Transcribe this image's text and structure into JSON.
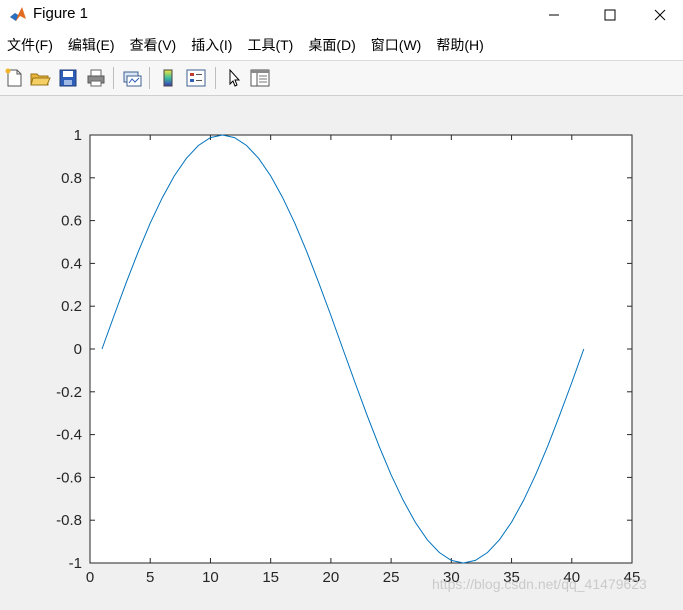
{
  "window": {
    "title": "Figure 1"
  },
  "menu": {
    "items": [
      "文件(F)",
      "编辑(E)",
      "查看(V)",
      "插入(I)",
      "工具(T)",
      "桌面(D)",
      "窗口(W)",
      "帮助(H)"
    ]
  },
  "toolbar": {
    "icons": [
      "new-figure-icon",
      "open-file-icon",
      "save-icon",
      "print-icon",
      "link-plot-icon",
      "colorbar-icon",
      "legend-icon",
      "pointer-icon",
      "property-editor-icon"
    ]
  },
  "colors": {
    "line": "#0072bd",
    "axes_bg": "#ffffff",
    "figure_bg": "#f0f0f0"
  },
  "watermark": "https://blog.csdn.net/qq_41479623",
  "chart_data": {
    "type": "line",
    "title": "",
    "xlabel": "",
    "ylabel": "",
    "xlim": [
      0,
      45
    ],
    "ylim": [
      -1,
      1
    ],
    "xticks": [
      0,
      5,
      10,
      15,
      20,
      25,
      30,
      35,
      40,
      45
    ],
    "yticks": [
      -1,
      -0.8,
      -0.6,
      -0.4,
      -0.2,
      0,
      0.2,
      0.4,
      0.6,
      0.8,
      1
    ],
    "xtick_labels": [
      "0",
      "5",
      "10",
      "15",
      "20",
      "25",
      "30",
      "35",
      "40",
      "45"
    ],
    "ytick_labels": [
      "-1",
      "-0.8",
      "-0.6",
      "-0.4",
      "-0.2",
      "0",
      "0.2",
      "0.4",
      "0.6",
      "0.8",
      "1"
    ],
    "grid": false,
    "series": [
      {
        "x": [
          1,
          2,
          3,
          4,
          5,
          6,
          7,
          8,
          9,
          10,
          11,
          12,
          13,
          14,
          15,
          16,
          17,
          18,
          19,
          20,
          21,
          22,
          23,
          24,
          25,
          26,
          27,
          28,
          29,
          30,
          31,
          32,
          33,
          34,
          35,
          36,
          37,
          38,
          39,
          40,
          41
        ],
        "values": [
          0,
          0.1564,
          0.309,
          0.454,
          0.5878,
          0.7071,
          0.809,
          0.891,
          0.9511,
          0.9877,
          1,
          0.9877,
          0.9511,
          0.891,
          0.809,
          0.7071,
          0.5878,
          0.454,
          0.309,
          0.1564,
          0,
          -0.1564,
          -0.309,
          -0.454,
          -0.5878,
          -0.7071,
          -0.809,
          -0.891,
          -0.9511,
          -0.9877,
          -1,
          -0.9877,
          -0.9511,
          -0.891,
          -0.809,
          -0.7071,
          -0.5878,
          -0.454,
          -0.309,
          -0.1564,
          0
        ]
      }
    ]
  }
}
